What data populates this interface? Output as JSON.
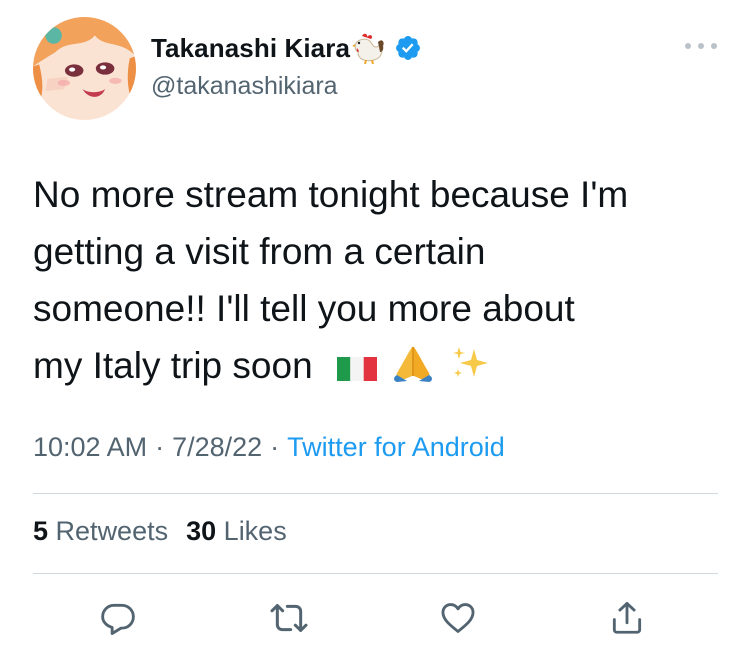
{
  "tweet": {
    "author": {
      "display_name": "Takanashi Kiara",
      "handle": "@takanashikiara",
      "name_emoji": "rooster-emoji",
      "verified_icon": "verified-badge-icon",
      "avatar": "anime-avatar-orange-hair"
    },
    "text_lines": [
      "No more stream tonight because I'm",
      "getting a visit from a certain",
      "someone!! I'll tell you more about",
      "my Italy trip soon"
    ],
    "trailing_emojis": [
      "italy-flag-emoji",
      "folded-hands-emoji",
      "sparkles-emoji"
    ],
    "time": "10:02 AM",
    "date": "7/28/22",
    "separator": "·",
    "source": "Twitter for Android",
    "stats": {
      "retweets_count": "5",
      "retweets_label": "Retweets",
      "likes_count": "30",
      "likes_label": "Likes"
    },
    "actions": [
      "reply-icon",
      "retweet-icon",
      "like-icon",
      "share-icon"
    ],
    "colors": {
      "link": "#1d9bf0",
      "secondary_text": "#536471",
      "primary_text": "#0f1419",
      "divider": "#cfd9de",
      "verified": "#1d9bf0"
    }
  }
}
